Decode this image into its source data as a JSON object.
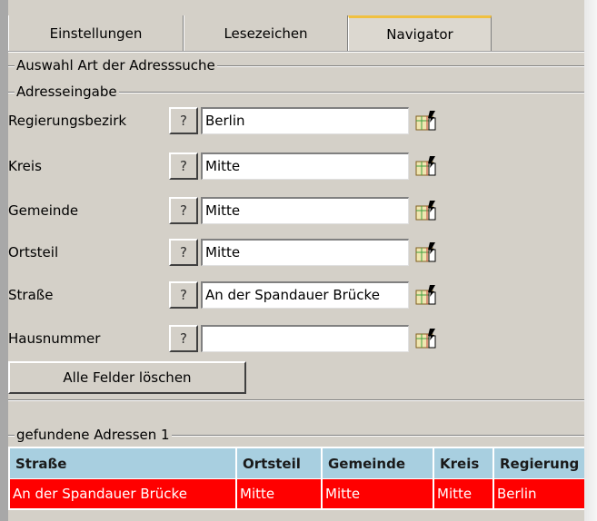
{
  "tabs": [
    {
      "label": "Einstellungen"
    },
    {
      "label": "Lesezeichen"
    },
    {
      "label": "Navigator"
    }
  ],
  "active_tab": "Navigator",
  "groups": {
    "search_type": "Auswahl Art der Adresssuche",
    "address_input": "Adresseingabe",
    "found": "gefundene Adressen 1"
  },
  "fields": [
    {
      "label": "Regierungsbezirk",
      "help": "?",
      "value": "Berlin",
      "icon": "map-pick-icon"
    },
    {
      "label": "Kreis",
      "help": "?",
      "value": "Mitte",
      "icon": "map-pick-icon"
    },
    {
      "label": "Gemeinde",
      "help": "?",
      "value": "Mitte",
      "icon": "map-pick-icon"
    },
    {
      "label": "Ortsteil",
      "help": "?",
      "value": "Mitte",
      "icon": "map-pick-icon"
    },
    {
      "label": "Straße",
      "help": "?",
      "value": "An der Spandauer Brücke",
      "icon": "map-pick-icon"
    },
    {
      "label": "Hausnummer",
      "help": "?",
      "value": "",
      "icon": "map-pick-icon"
    }
  ],
  "clear_button": "Alle Felder löschen",
  "results": {
    "columns": [
      "Straße",
      "Ortsteil",
      "Gemeinde",
      "Kreis",
      "Regierung"
    ],
    "rows": [
      [
        "An der Spandauer Brücke",
        "Mitte",
        "Mitte",
        "Mitte",
        "Berlin"
      ]
    ]
  },
  "colors": {
    "header_bg": "#a8cfe0",
    "selected_row_bg": "#ff0000",
    "active_tab_accent": "#f0c040"
  }
}
